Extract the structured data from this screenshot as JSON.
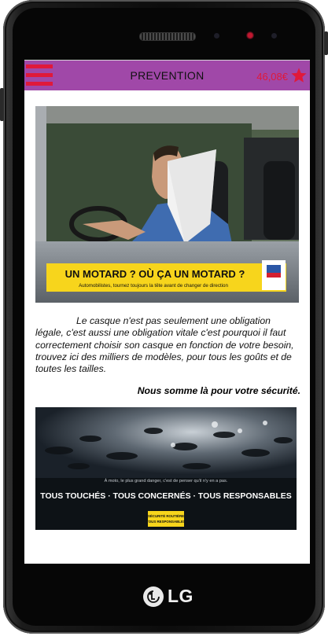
{
  "device": {
    "brand": "LG"
  },
  "header": {
    "title": "PREVENTION",
    "price": "46,08€",
    "menu_icon": "hamburger-icon",
    "favorite_icon": "star-icon",
    "bar_color": "#a048a8",
    "accent_color": "#e0193a"
  },
  "banner1": {
    "headline": "UN MOTARD ? OÙ ÇA UN MOTARD ?",
    "subline": "Automobilistes, tournez toujours la tête avant de changer de direction"
  },
  "body": {
    "paragraph": "Le casque n'est pas seulement une obligation légale, c'est aussi une obligation vitale c'est pourquoi il faut correctement choisir son casque en fonction de votre besoin, trouvez ici des milliers de modèles, pour tous les goûts et de toutes les tailles.",
    "tagline": "Nous somme là pour votre sécurité."
  },
  "banner2": {
    "caption": "À moto, le plus grand danger, c'est de penser qu'il n'y en a pas.",
    "slogan": "TOUS TOUCHÉS · TOUS CONCERNÉS · TOUS RESPONSABLES",
    "badge_line1": "SÉCURITÉ ROUTIÈRE",
    "badge_line2": "TOUS RESPONSABLES"
  }
}
